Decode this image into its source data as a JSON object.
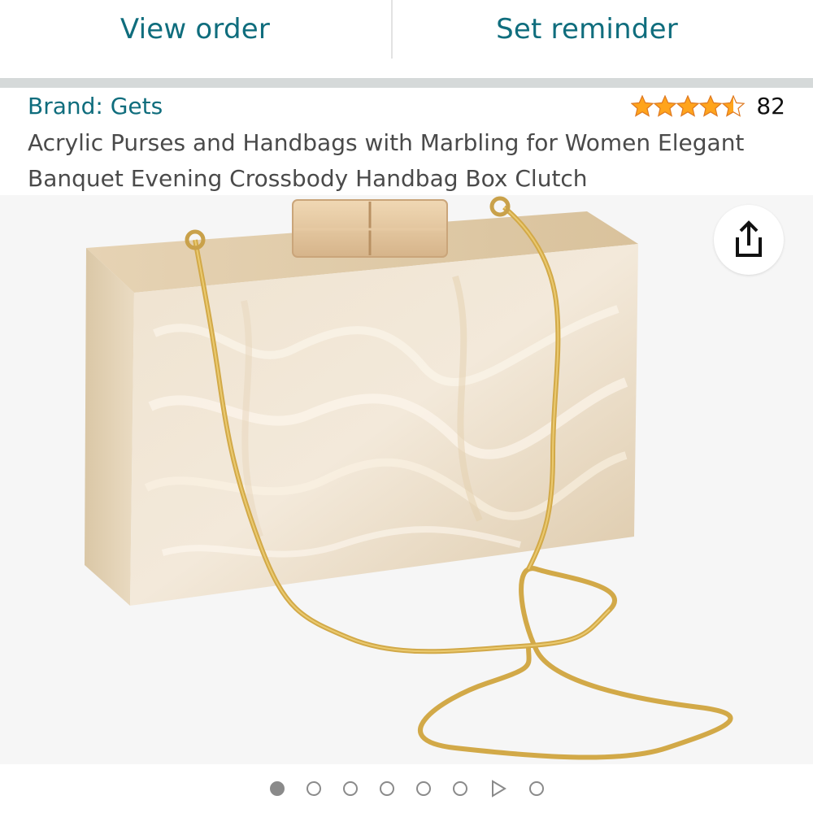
{
  "top_actions": {
    "view_order_label": "View order",
    "set_reminder_label": "Set reminder"
  },
  "product": {
    "brand_label": "Brand: Gets",
    "rating_value": 4.5,
    "rating_count": "82",
    "title": "Acrylic Purses and Handbags with Marbling for Women Elegant Banquet Evening Crossbody Handbag Box Clutch"
  },
  "gallery": {
    "share_icon": "share-icon",
    "image_icon": "marbled-clutch-handbag-with-gold-chain",
    "pager": [
      {
        "type": "dot",
        "active": true
      },
      {
        "type": "dot",
        "active": false
      },
      {
        "type": "dot",
        "active": false
      },
      {
        "type": "dot",
        "active": false
      },
      {
        "type": "dot",
        "active": false
      },
      {
        "type": "dot",
        "active": false
      },
      {
        "type": "play",
        "active": false
      },
      {
        "type": "dot",
        "active": false
      }
    ]
  },
  "colors": {
    "link_teal": "#0f6d7d",
    "star_orange": "#ffa41c",
    "divider_gray": "#d5d9d9"
  }
}
